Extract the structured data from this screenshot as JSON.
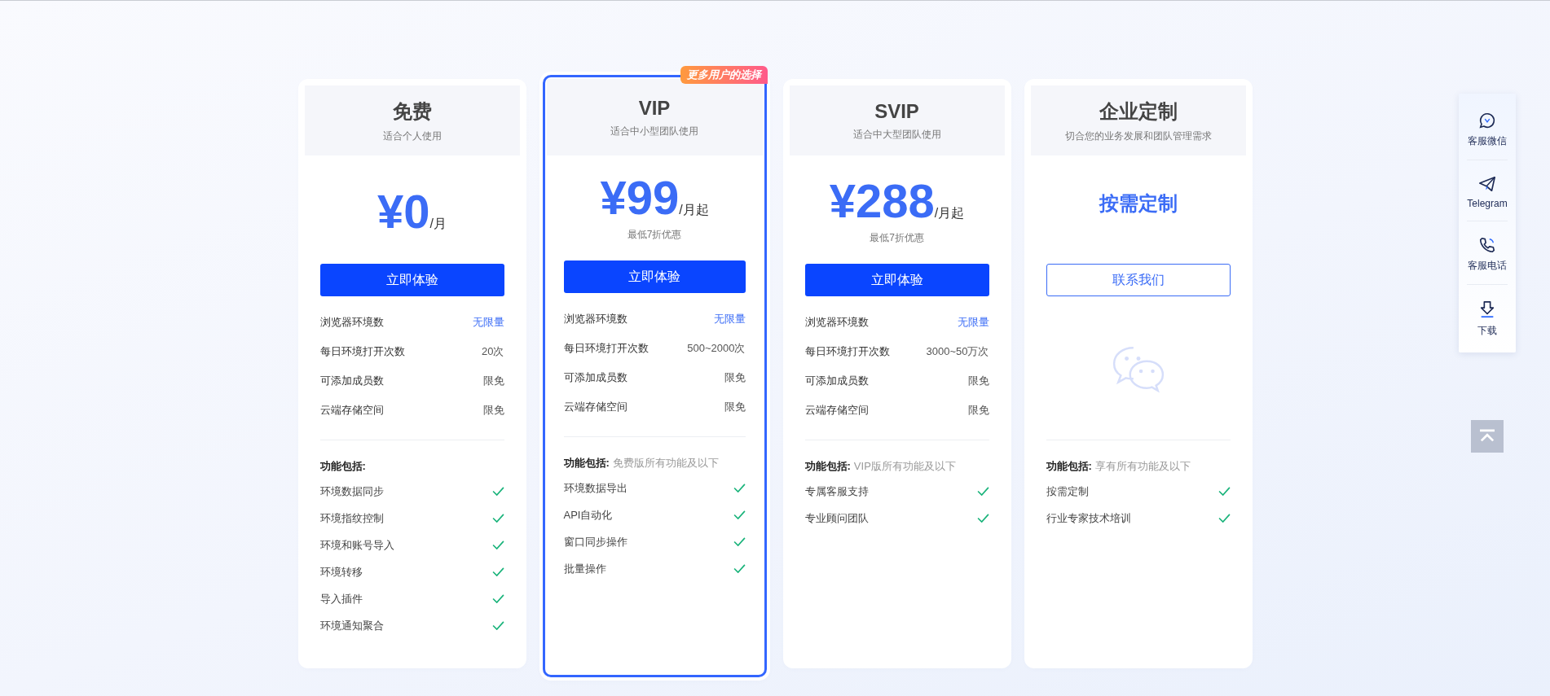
{
  "plans": [
    {
      "kind": "plan",
      "highlight": false,
      "title": "免费",
      "subtitle": "适合个人使用",
      "price": "¥0",
      "unit": "/月",
      "button": {
        "label": "立即体验",
        "kind": "primary"
      },
      "quotas": [
        {
          "label": "浏览器环境数",
          "value": "无限量",
          "highlight": true
        },
        {
          "label": "每日环境打开次数",
          "value": "20次",
          "highlight": false
        },
        {
          "label": "可添加成员数",
          "value": "限免",
          "highlight": false
        },
        {
          "label": "云端存储空间",
          "value": "限免",
          "highlight": false
        }
      ],
      "features_label": "功能包括:",
      "features": [
        "环境数据同步",
        "环境指纹控制",
        "环境和账号导入",
        "环境转移",
        "导入插件",
        "环境通知聚合"
      ]
    },
    {
      "kind": "plan",
      "highlight": true,
      "badge": "更多用户的选择",
      "title": "VIP",
      "subtitle": "适合中小型团队使用",
      "price": "¥99",
      "unit": "/月起",
      "price_note": "最低7折优惠",
      "button": {
        "label": "立即体验",
        "kind": "primary"
      },
      "quotas": [
        {
          "label": "浏览器环境数",
          "value": "无限量",
          "highlight": true
        },
        {
          "label": "每日环境打开次数",
          "value": "500~2000次",
          "highlight": false
        },
        {
          "label": "可添加成员数",
          "value": "限免",
          "highlight": false
        },
        {
          "label": "云端存储空间",
          "value": "限免",
          "highlight": false
        }
      ],
      "features_label": "功能包括:",
      "features_note": "免费版所有功能及以下",
      "features": [
        "环境数据导出",
        "API自动化",
        "窗口同步操作",
        "批量操作"
      ]
    },
    {
      "kind": "plan",
      "highlight": false,
      "title": "SVIP",
      "subtitle": "适合中大型团队使用",
      "price": "¥288",
      "unit": "/月起",
      "price_note": "最低7折优惠",
      "button": {
        "label": "立即体验",
        "kind": "primary"
      },
      "quotas": [
        {
          "label": "浏览器环境数",
          "value": "无限量",
          "highlight": true
        },
        {
          "label": "每日环境打开次数",
          "value": "3000~50万次",
          "highlight": false
        },
        {
          "label": "可添加成员数",
          "value": "限免",
          "highlight": false
        },
        {
          "label": "云端存储空间",
          "value": "限免",
          "highlight": false
        }
      ],
      "features_label": "功能包括:",
      "features_note": "VIP版所有功能及以下",
      "features": [
        "专属客服支持",
        "专业顾问团队"
      ]
    },
    {
      "kind": "custom",
      "highlight": false,
      "title": "企业定制",
      "subtitle": "切合您的业务发展和团队管理需求",
      "price": "按需定制",
      "button": {
        "label": "联系我们",
        "kind": "outline"
      },
      "features_label": "功能包括:",
      "features_note": "享有所有功能及以下",
      "features": [
        "按需定制",
        "行业专家技术培训"
      ]
    }
  ],
  "sidebar": {
    "items": [
      {
        "label": "客服微信"
      },
      {
        "label": "Telegram"
      },
      {
        "label": "客服电话"
      },
      {
        "label": "下载"
      }
    ]
  }
}
